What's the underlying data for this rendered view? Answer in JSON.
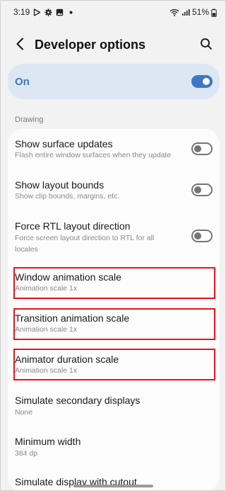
{
  "status_bar": {
    "time": "3:19",
    "battery": "51%",
    "left_icons": [
      "play-store-icon",
      "gear-icon",
      "gallery-icon",
      "dot-icon"
    ],
    "right_icons": [
      "wifi-icon",
      "signal-icon",
      "battery-icon"
    ]
  },
  "header": {
    "title": "Developer options",
    "back_icon": "back-icon",
    "search_icon": "search-icon"
  },
  "master_switch": {
    "label": "On",
    "state": true,
    "accent_color": "#3e78c4"
  },
  "section": {
    "title": "Drawing"
  },
  "items": [
    {
      "title": "Show surface updates",
      "subtitle": "Flash entire window surfaces when they update",
      "toggle": false
    },
    {
      "title": "Show layout bounds",
      "subtitle": "Show clip bounds, margins, etc.",
      "toggle": false
    },
    {
      "title": "Force RTL layout direction",
      "subtitle": "Force screen layout direction to RTL for all locales",
      "toggle": false
    },
    {
      "title": "Window animation scale",
      "subtitle": "Animation scale 1x",
      "highlighted": true
    },
    {
      "title": "Transition animation scale",
      "subtitle": "Animation scale 1x",
      "highlighted": true
    },
    {
      "title": "Animator duration scale",
      "subtitle": "Animation scale 1x",
      "highlighted": true
    },
    {
      "title": "Simulate secondary displays",
      "subtitle": "None"
    },
    {
      "title": "Minimum width",
      "subtitle": "384 dp"
    },
    {
      "title": "Simulate display with cutout",
      "subtitle": ""
    }
  ],
  "highlight_color": "#e8141b"
}
